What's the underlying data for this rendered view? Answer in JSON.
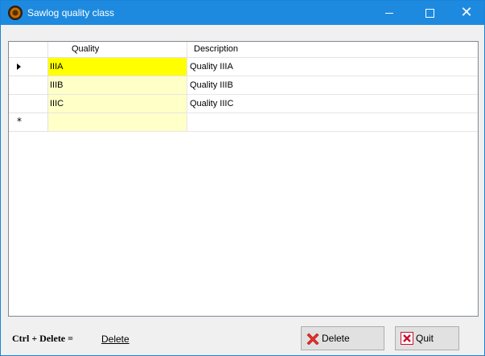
{
  "window": {
    "title": "Sawlog quality class"
  },
  "grid": {
    "columns": [
      "Quality",
      "Description"
    ],
    "rows": [
      {
        "quality": "IIIA",
        "description": "Quality IIIA"
      },
      {
        "quality": "IIIB",
        "description": "Quality IIIB"
      },
      {
        "quality": "IIIC",
        "description": "Quality IIIC"
      }
    ]
  },
  "footer": {
    "shortcut_label": "Ctrl + Delete =",
    "shortcut_action": "Delete",
    "delete_button": "Delete",
    "quit_button": "Quit"
  },
  "colors": {
    "titlebar": "#1d8ae0",
    "selected_cell": "#ffff00",
    "quality_column": "#ffffc8"
  },
  "icons": [
    "app-icon",
    "minimize-icon",
    "maximize-icon",
    "close-icon",
    "row-pointer-icon",
    "new-row-icon",
    "delete-icon",
    "quit-icon"
  ]
}
